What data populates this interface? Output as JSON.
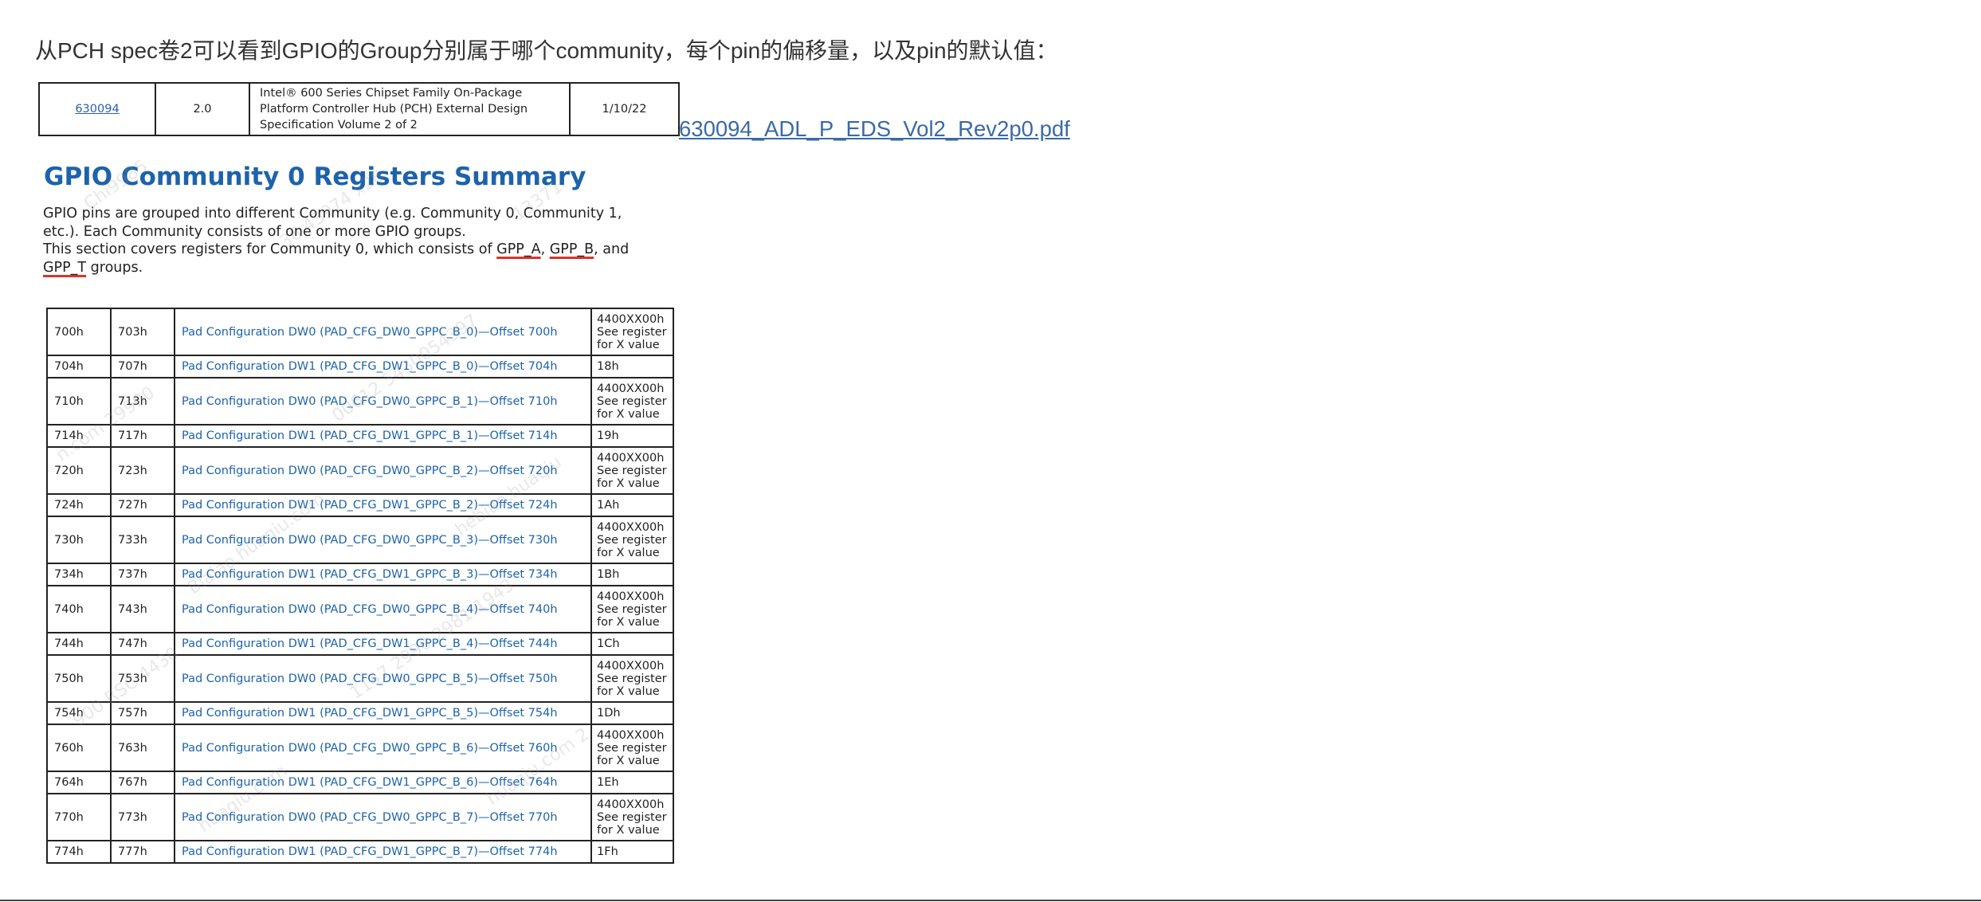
{
  "intro": "从PCH spec卷2可以看到GPIO的Group分别属于哪个community，每个pin的偏移量，以及pin的默认值：",
  "docinfo": {
    "number": "630094",
    "revision": "2.0",
    "title_lines": [
      "Intel® 600 Series Chipset Family On-Package",
      "Platform Controller Hub (PCH) External Design",
      "Specification Volume 2 of 2"
    ],
    "date": "1/10/22"
  },
  "pdf_link": "630094_ADL_P_EDS_Vol2_Rev2p0.pdf",
  "heading": "GPIO Community 0 Registers Summary",
  "description": {
    "line1": "GPIO pins are grouped into different Community (e.g. Community 0, Community 1,",
    "line2": "etc.). Each Community consists of one or more GPIO groups.",
    "line3_pre": "This section covers registers for Community 0, which consists of ",
    "group_a": "GPP_A",
    "sep1": ", ",
    "group_b": "GPP_B",
    "sep2": ", and",
    "group_t": "GPP_T",
    "line4_post": " groups."
  },
  "registers": [
    {
      "start": "700h",
      "end": "703h",
      "name": "Pad Configuration DW0 (PAD_CFG_DW0_GPPC_B_0)—Offset 700h",
      "default": [
        "4400XX00h",
        "See register",
        "for X value"
      ]
    },
    {
      "start": "704h",
      "end": "707h",
      "name": "Pad Configuration DW1 (PAD_CFG_DW1_GPPC_B_0)—Offset 704h",
      "default": [
        "18h"
      ]
    },
    {
      "start": "710h",
      "end": "713h",
      "name": "Pad Configuration DW0 (PAD_CFG_DW0_GPPC_B_1)—Offset 710h",
      "default": [
        "4400XX00h",
        "See register",
        "for X value"
      ]
    },
    {
      "start": "714h",
      "end": "717h",
      "name": "Pad Configuration DW1 (PAD_CFG_DW1_GPPC_B_1)—Offset 714h",
      "default": [
        "19h"
      ]
    },
    {
      "start": "720h",
      "end": "723h",
      "name": "Pad Configuration DW0 (PAD_CFG_DW0_GPPC_B_2)—Offset 720h",
      "default": [
        "4400XX00h",
        "See register",
        "for X value"
      ]
    },
    {
      "start": "724h",
      "end": "727h",
      "name": "Pad Configuration DW1 (PAD_CFG_DW1_GPPC_B_2)—Offset 724h",
      "default": [
        "1Ah"
      ]
    },
    {
      "start": "730h",
      "end": "733h",
      "name": "Pad Configuration DW0 (PAD_CFG_DW0_GPPC_B_3)—Offset 730h",
      "default": [
        "4400XX00h",
        "See register",
        "for X value"
      ]
    },
    {
      "start": "734h",
      "end": "737h",
      "name": "Pad Configuration DW1 (PAD_CFG_DW1_GPPC_B_3)—Offset 734h",
      "default": [
        "1Bh"
      ]
    },
    {
      "start": "740h",
      "end": "743h",
      "name": "Pad Configuration DW0 (PAD_CFG_DW0_GPPC_B_4)—Offset 740h",
      "default": [
        "4400XX00h",
        "See register",
        "for X value"
      ]
    },
    {
      "start": "744h",
      "end": "747h",
      "name": "Pad Configuration DW1 (PAD_CFG_DW1_GPPC_B_4)—Offset 744h",
      "default": [
        "1Ch"
      ]
    },
    {
      "start": "750h",
      "end": "753h",
      "name": "Pad Configuration DW0 (PAD_CFG_DW0_GPPC_B_5)—Offset 750h",
      "default": [
        "4400XX00h",
        "See register",
        "for X value"
      ]
    },
    {
      "start": "754h",
      "end": "757h",
      "name": "Pad Configuration DW1 (PAD_CFG_DW1_GPPC_B_5)—Offset 754h",
      "default": [
        "1Dh"
      ]
    },
    {
      "start": "760h",
      "end": "763h",
      "name": "Pad Configuration DW0 (PAD_CFG_DW0_GPPC_B_6)—Offset 760h",
      "default": [
        "4400XX00h",
        "See register",
        "for X value"
      ]
    },
    {
      "start": "764h",
      "end": "767h",
      "name": "Pad Configuration DW1 (PAD_CFG_DW1_GPPC_B_6)—Offset 764h",
      "default": [
        "1Eh"
      ]
    },
    {
      "start": "770h",
      "end": "773h",
      "name": "Pad Configuration DW0 (PAD_CFG_DW0_GPPC_B_7)—Offset 770h",
      "default": [
        "4400XX00h",
        "See register",
        "for X value"
      ]
    },
    {
      "start": "774h",
      "end": "777h",
      "name": "Pad Configuration DW1 (PAD_CFG_DW1_GPPC_B_7)—Offset 774h",
      "default": [
        "1Fh"
      ]
    }
  ],
  "colors": {
    "heading": "#1d63ab",
    "register_link": "#1d63ab",
    "pdf_link": "#3a6aa5",
    "underline_marker": "#d9342b"
  }
}
